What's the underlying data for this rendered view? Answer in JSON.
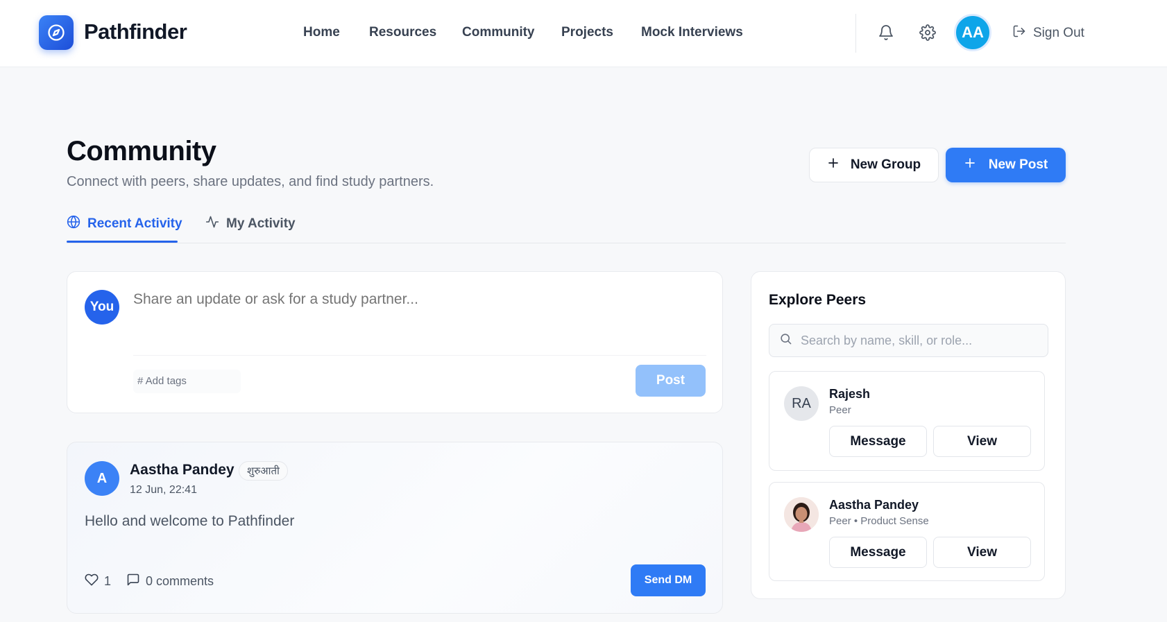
{
  "brand": {
    "name": "Pathfinder"
  },
  "nav": {
    "items": [
      {
        "label": "Home"
      },
      {
        "label": "Resources"
      },
      {
        "label": "Community"
      },
      {
        "label": "Projects"
      },
      {
        "label": "Mock Interviews"
      }
    ]
  },
  "header": {
    "avatar_initials": "AA",
    "sign_out_label": "Sign Out",
    "icons": [
      "bell-icon",
      "gear-icon",
      "sign-out-icon"
    ]
  },
  "page": {
    "title": "Community",
    "subtitle": "Connect with peers, share updates, and find study partners.",
    "new_group_label": "New Group",
    "new_post_label": "New Post"
  },
  "tabs": [
    {
      "label": "Recent Activity",
      "active": true,
      "icon": "globe-icon"
    },
    {
      "label": "My Activity",
      "active": false,
      "icon": "activity-icon"
    }
  ],
  "composer": {
    "avatar_label": "You",
    "placeholder": "Share an update or ask for a study partner...",
    "tags_placeholder": "# Add tags",
    "post_label": "Post"
  },
  "post": {
    "avatar_initial": "A",
    "author": "Aastha Pandey",
    "badge": "शुरुआती",
    "timestamp": "12 Jun, 22:41",
    "body": "Hello and welcome to Pathfinder",
    "likes": "1",
    "comments": "0 comments",
    "send_dm_label": "Send DM"
  },
  "peers": {
    "title": "Explore Peers",
    "search_placeholder": "Search by name, skill, or role...",
    "items": [
      {
        "initials": "RA",
        "name": "Rajesh",
        "role": "Peer",
        "message_label": "Message",
        "view_label": "View"
      },
      {
        "initials": "",
        "name": "Aastha Pandey",
        "role": "Peer • Product Sense",
        "message_label": "Message",
        "view_label": "View"
      }
    ]
  },
  "colors": {
    "primary": "#2f7bf5",
    "primary_disabled": "#93c1fb",
    "active_tab": "#2563eb",
    "avatar": "#0ea5e9"
  }
}
